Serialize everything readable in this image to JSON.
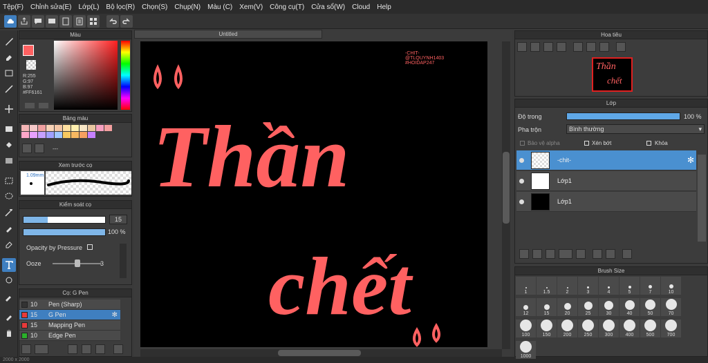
{
  "menu": [
    "Tệp(F)",
    "Chỉnh sửa(E)",
    "Lớp(L)",
    "Bộ lọc(R)",
    "Chọn(S)",
    "Chụp(N)",
    "Màu (C)",
    "Xem(V)",
    "Công cụ(T)",
    "Cửa sổ(W)",
    "Cloud",
    "Help"
  ],
  "document": {
    "tab_title": "Untitled"
  },
  "canvas": {
    "text_line1": "Thần",
    "text_line2": "chết",
    "watermark": [
      "-CHIT-",
      "@TLQUYNH1403",
      "#HOIDAP247"
    ],
    "text_color": "#ff6161"
  },
  "color_panel": {
    "title": "Màu",
    "r": "R:255",
    "g": "G:97",
    "b": "B:97",
    "hex": "#FF6161",
    "fg_color": "#ff6161"
  },
  "palette_panel": {
    "title": "Bảng màu",
    "dots": "---",
    "swatches": [
      "#f4b6b6",
      "#f6c9c9",
      "#f0a0a0",
      "#f7d2b6",
      "#f4c6a6",
      "#ffe0a0",
      "#fff0b0",
      "#f8e6c6",
      "#e8c6a0",
      "#f6a0c0",
      "#f4a0a0",
      "#ffa7c9",
      "#e8a0ff",
      "#c6a0ff",
      "#a0a0ff",
      "#a0c6ff",
      "#f7c960",
      "#f7b860",
      "#f7a060",
      "#c680ff"
    ]
  },
  "brush_preview": {
    "title": "Xem trước cọ",
    "size": "1.09mm"
  },
  "brush_control": {
    "title": "Kiểm soát cọ",
    "size_value": "15",
    "opacity_value": "100 %",
    "pressure_label": "Opacity by Pressure",
    "ooze_label": "Ooze",
    "ooze_value": "3",
    "size_fraction": 0.3,
    "opacity_fraction": 1.0
  },
  "brush_list": {
    "title": "Cọ: G Pen",
    "items": [
      {
        "size": "10",
        "name": "Pen (Sharp)",
        "color": "#333333"
      },
      {
        "size": "15",
        "name": "G Pen",
        "color": "#e83a3a"
      },
      {
        "size": "15",
        "name": "Mapping Pen",
        "color": "#e83a3a"
      },
      {
        "size": "10",
        "name": "Edge Pen",
        "color": "#2ab02a"
      }
    ]
  },
  "navigator": {
    "title": "Hoa tiêu",
    "thumb_line1": "Thần",
    "thumb_line2": "chết"
  },
  "layers": {
    "title": "Lớp",
    "opacity_label": "Độ trong",
    "opacity_value": "100 %",
    "opacity_fraction": 1.0,
    "blend_label": "Pha trộn",
    "blend_value": "Bình thường",
    "protect_alpha": "Bảo vệ alpha",
    "clipping": "Xén bớt",
    "lock": "Khóa",
    "items": [
      {
        "name": "-chit-",
        "selected": true
      },
      {
        "name": "Lớp1",
        "selected": false
      },
      {
        "name": "Lớp1",
        "selected": false
      }
    ]
  },
  "brush_size": {
    "title": "Brush Size",
    "values": [
      "1",
      "1.5",
      "2",
      "3",
      "4",
      "5",
      "7",
      "10",
      "12",
      "15",
      "20",
      "25",
      "30",
      "40",
      "50",
      "70",
      "100",
      "150",
      "200",
      "250",
      "300",
      "400",
      "500",
      "700",
      "1000"
    ]
  },
  "status": {
    "text": "2000 x 2000"
  }
}
